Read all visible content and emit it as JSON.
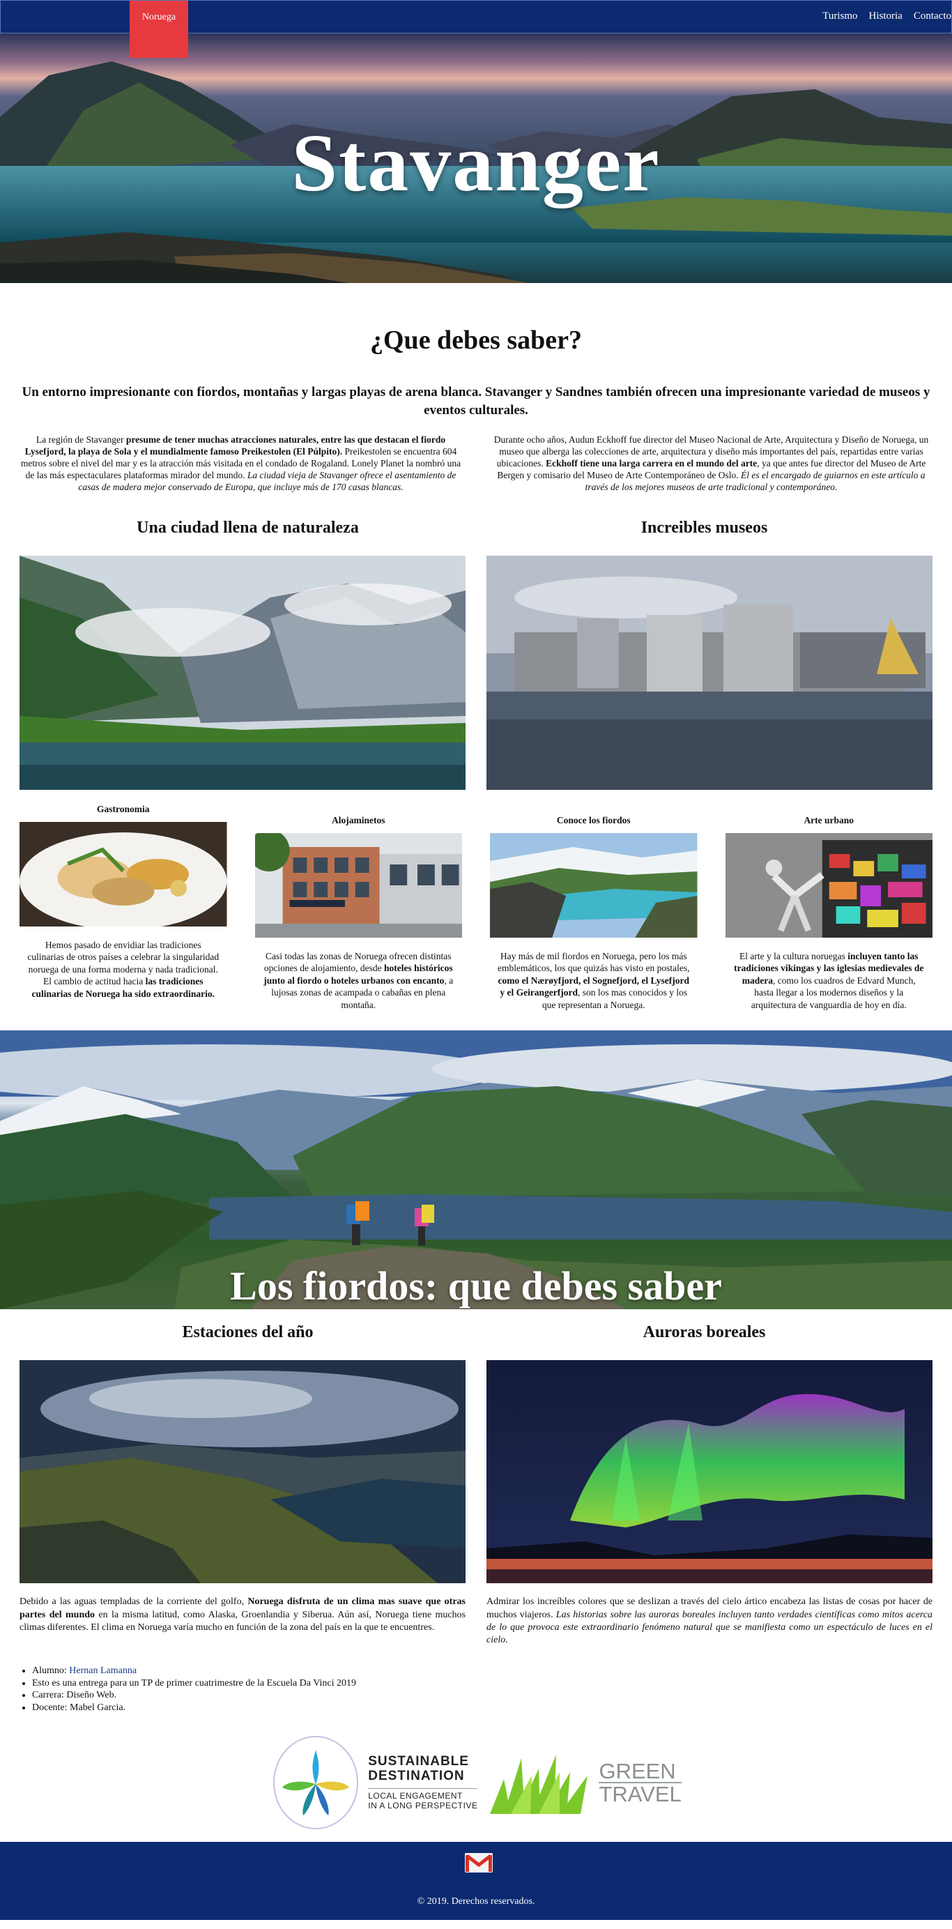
{
  "nav": {
    "brand": "Noruega",
    "links": [
      "Turismo",
      "Historia",
      "Contacto"
    ]
  },
  "hero": {
    "title": "Stavanger"
  },
  "intro": {
    "title": "¿Que debes saber?",
    "lead": "Un entorno impresionante con fiordos, montañas y largas playas de arena blanca. Stavanger y Sandnes también ofrecen una impresionante variedad de museos y eventos culturales.",
    "left": {
      "t1": "La región de Stavanger ",
      "b1": "presume de tener muchas atracciones naturales, entre las que destacan el fiordo Lysefjord, la playa de Sola y el mundialmente famoso Preikestolen (El Púlpito).",
      "t2": " Preikestolen se encuentra 604 metros sobre el nivel del mar y es la atracción más visitada en el condado de Rogaland. Lonely Planet la nombró una de las más espectaculares plataformas mirador del mundo.",
      "i1": "La ciudad vieja de Stavanger ofrece el asentamiento de casas de madera mejor conservado de Europa, que incluye más de 170 casas blancas."
    },
    "right": {
      "t1": "Durante ocho años, Audun Eckhoff fue director del Museo Nacional de Arte, Arquitectura y Diseño de Noruega, un museo que alberga las colecciones de arte, arquitectura y diseño más importantes del país, repartidas entre varias ubicaciones. ",
      "b1": "Eckhoff tiene una larga carrera en el mundo del arte",
      "t2": ", ya que antes fue director del Museo de Arte Bergen y comisario del Museo de Arte Contemporáneo de Oslo. ",
      "i1": "Él es el encargado de guiarnos en este artículo a través de los mejores museos de arte tradicional y contemporáneo."
    }
  },
  "features": {
    "left_title": "Una ciudad llena de naturaleza",
    "right_title": "Increibles museos"
  },
  "cards": [
    {
      "title": "Gastronomia",
      "t1": "Hemos pasado de envidiar las tradiciones culinarias de otros países a celebrar la singularidad noruega de una forma moderna y nada tradicional. El cambio de actitud hacia ",
      "b1": "las tradiciones culinarias de Noruega ha sido extraordinario.",
      "t2": ""
    },
    {
      "title": "Alojaminetos",
      "t1": "Casi todas las zonas de Noruega ofrecen distintas opciones de alojamiento, desde ",
      "b1": "hoteles históricos junto al fiordo o hoteles urbanos con encanto",
      "t2": ", a lujosas zonas de acampada o cabañas en plena montaña."
    },
    {
      "title": "Conoce los fiordos",
      "t1": "Hay más de mil fiordos en Noruega, pero los más emblemáticos, los que quizás has visto en postales, ",
      "b1": "como el Nærøyfjord, el Sognefjord, el Lysefjord y el Geirangerfjord",
      "t2": ", son los mas conocidos y los que representan a Noruega."
    },
    {
      "title": "Arte urbano",
      "t1": "El arte y la cultura noruegas ",
      "b1": "incluyen tanto las tradiciones vikingas y las iglesias medievales de madera",
      "t2": ", como los cuadros de Edvard Munch, hasta llegar a los modernos diseños y la arquitectura de vanguardia de hoy en día."
    }
  ],
  "banner": {
    "title": "Los fiordos: que debes saber"
  },
  "seasons": {
    "left_title": "Estaciones del año",
    "right_title": "Auroras boreales",
    "left": {
      "t1": "Debido a las aguas templadas de la corriente del golfo, ",
      "b1": "Noruega disfruta de un clima mas suave que otras partes del mundo",
      "t2": " en la misma latitud, como Alaska, Groenlandia y Siberua. Aún así, Noruega tiene muchos climas diferentes. El clima en Noruega varía mucho en función de la zona del país en la que te encuentres."
    },
    "right": {
      "t1": "Admirar los increíbles colores que se deslizan a través del cielo ártico encabeza las listas de cosas por hacer de muchos viajeros. ",
      "i1": "Las historias sobre las auroras boreales incluyen tanto verdades científicas como mitos acerca de lo que provoca este extraordinario fenómeno natural que se manifiesta como un espectáculo de luces en el cielo."
    }
  },
  "credits": {
    "alumno_label": "Alumno: ",
    "alumno_name": "Hernan Lamanna",
    "item2": "Esto es una entrega para un TP de primer cuatrimestre de la Escuela Da Vinci 2019",
    "item3": "Carrera: Diseño Web.",
    "item4": "Docente: Mabel Garcia."
  },
  "logos": {
    "sd_line1": "SUSTAINABLE",
    "sd_line2": "DESTINATION",
    "sd_sub1": "LOCAL ENGAGEMENT",
    "sd_sub2": "IN A LONG PERSPECTIVE",
    "gt_line1": "GREEN",
    "gt_line2": "TRAVEL"
  },
  "footer": {
    "copyright": "© 2019. Derechos reservados."
  },
  "icons": {
    "mail": "gmail-icon"
  },
  "colors": {
    "nav_bg": "#0b2a6f",
    "brand_bg": "#e63a3f",
    "link": "#1a3b8f"
  }
}
